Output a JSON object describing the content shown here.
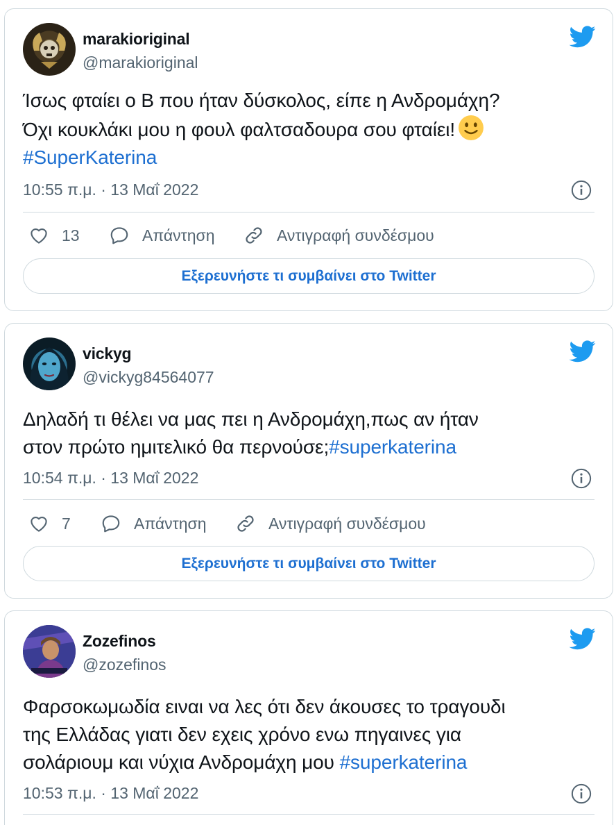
{
  "tweets": [
    {
      "name": "marakioriginal",
      "handle": "@marakioriginal",
      "lines": [
        [
          "Ίσως φταίει ο Β που ήταν δύσκολος, είπε η Ανδρομάχη?"
        ],
        [
          "Όχι κουκλάκι μου η φουλ φαλτσαδουρα σου φταίει!"
        ],
        [
          "#SuperKaterina"
        ]
      ],
      "timestamp": "10:55 π.μ. · 13 Μαΐ 2022",
      "likes": "13",
      "reply_label": "Απάντηση",
      "copy_link_label": "Αντιγραφή συνδέσμου",
      "explore_label": "Εξερευνήστε τι συμβαίνει στο Twitter"
    },
    {
      "name": "vickyg",
      "handle": "@vickyg84564077",
      "lines": [
        [
          "Δηλαδή τι θέλει να μας πει η Ανδρομάχη,πως αν ήταν"
        ],
        [
          "στον πρώτο ημιτελικό θα περνούσε;",
          "#superkaterina"
        ]
      ],
      "timestamp": "10:54 π.μ. · 13 Μαΐ 2022",
      "likes": "7",
      "reply_label": "Απάντηση",
      "copy_link_label": "Αντιγραφή συνδέσμου",
      "explore_label": "Εξερευνήστε τι συμβαίνει στο Twitter"
    },
    {
      "name": "Zozefinos",
      "handle": "@zozefinos",
      "lines": [
        [
          "Φαρσοκωμωδία ειναι να λες ότι δεν άκουσες το τραγουδι"
        ],
        [
          "της Ελλάδας γιατι δεν εχεις χρόνο ενω πηγαινες για"
        ],
        [
          "σολάριουμ και νύχια Ανδρομάχη μου ",
          "#superkaterina"
        ]
      ],
      "timestamp": "10:53 π.μ. · 13 Μαΐ 2022"
    }
  ],
  "icons": {
    "brand": "twitter-bird-icon",
    "like": "heart-icon",
    "reply": "speech-bubble-icon",
    "copy_link": "link-icon",
    "info": "info-icon",
    "emoji": "slightly-smiling-face-emoji"
  },
  "colors": {
    "twitter_blue": "#1d9bf0",
    "hashtag": "#1d6fd1",
    "secondary_text": "#536471",
    "border": "#cfd9de"
  }
}
